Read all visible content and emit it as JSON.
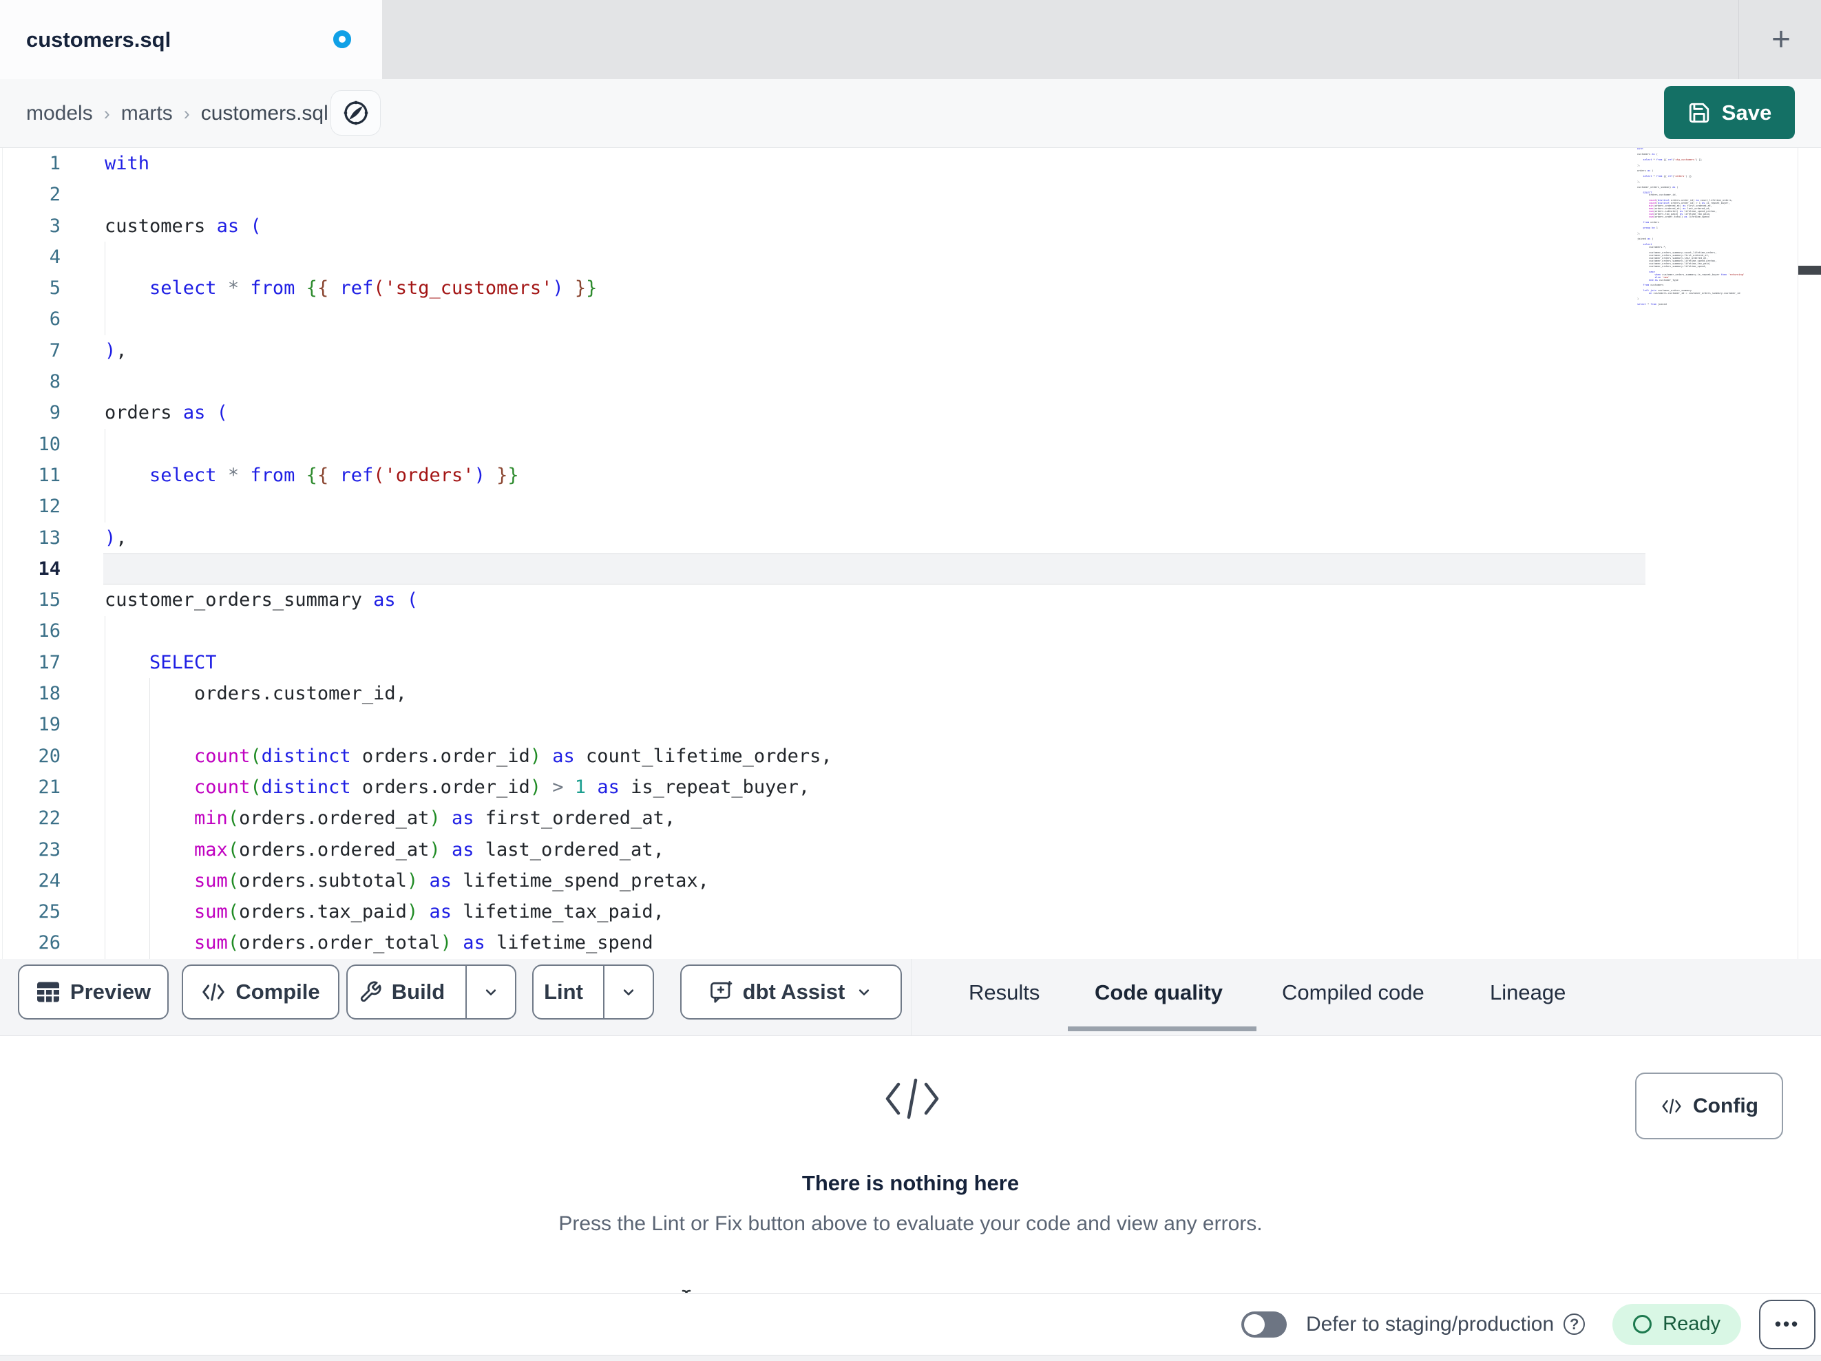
{
  "tab": {
    "title": "customers.sql"
  },
  "tabstrip": {
    "new_tab_glyph": "+"
  },
  "breadcrumb": {
    "items": [
      "models",
      "marts",
      "customers.sql"
    ],
    "separator": "›"
  },
  "save": {
    "label": "Save"
  },
  "editor": {
    "active_line": 14,
    "lines": [
      {
        "n": 1,
        "t": [
          [
            "with",
            "kw"
          ]
        ]
      },
      {
        "n": 2,
        "t": []
      },
      {
        "n": 3,
        "t": [
          [
            "customers",
            ""
          ],
          [
            " ",
            ""
          ],
          [
            "as",
            "kw"
          ],
          [
            " ",
            ""
          ],
          [
            "(",
            "kw"
          ]
        ]
      },
      {
        "n": 4,
        "t": []
      },
      {
        "n": 5,
        "t": [
          [
            "    ",
            ""
          ],
          [
            "select",
            "kw"
          ],
          [
            " ",
            ""
          ],
          [
            "*",
            "op"
          ],
          [
            " ",
            ""
          ],
          [
            "from",
            "kw"
          ],
          [
            " ",
            ""
          ],
          [
            "{",
            "bg"
          ],
          [
            "{",
            "bm"
          ],
          [
            " ",
            ""
          ],
          [
            "ref",
            "kw"
          ],
          [
            "(",
            "str"
          ],
          [
            "'stg_customers'",
            "str"
          ],
          [
            ")",
            "kw"
          ],
          [
            " ",
            ""
          ],
          [
            "}",
            "bm"
          ],
          [
            "}",
            "bg"
          ]
        ]
      },
      {
        "n": 6,
        "t": []
      },
      {
        "n": 7,
        "t": [
          [
            ")",
            "kw"
          ],
          [
            ",",
            ""
          ]
        ]
      },
      {
        "n": 8,
        "t": []
      },
      {
        "n": 9,
        "t": [
          [
            "orders",
            ""
          ],
          [
            " ",
            ""
          ],
          [
            "as",
            "kw"
          ],
          [
            " ",
            ""
          ],
          [
            "(",
            "kw"
          ]
        ]
      },
      {
        "n": 10,
        "t": []
      },
      {
        "n": 11,
        "t": [
          [
            "    ",
            ""
          ],
          [
            "select",
            "kw"
          ],
          [
            " ",
            ""
          ],
          [
            "*",
            "op"
          ],
          [
            " ",
            ""
          ],
          [
            "from",
            "kw"
          ],
          [
            " ",
            ""
          ],
          [
            "{",
            "bg"
          ],
          [
            "{",
            "bm"
          ],
          [
            " ",
            ""
          ],
          [
            "ref",
            "kw"
          ],
          [
            "(",
            "str"
          ],
          [
            "'orders'",
            "str"
          ],
          [
            ")",
            "kw"
          ],
          [
            " ",
            ""
          ],
          [
            "}",
            "bm"
          ],
          [
            "}",
            "bg"
          ]
        ]
      },
      {
        "n": 12,
        "t": []
      },
      {
        "n": 13,
        "t": [
          [
            ")",
            "kw"
          ],
          [
            ",",
            ""
          ]
        ]
      },
      {
        "n": 14,
        "t": []
      },
      {
        "n": 15,
        "t": [
          [
            "customer_orders_summary",
            ""
          ],
          [
            " ",
            ""
          ],
          [
            "as",
            "kw"
          ],
          [
            " ",
            ""
          ],
          [
            "(",
            "kw"
          ]
        ]
      },
      {
        "n": 16,
        "t": []
      },
      {
        "n": 17,
        "t": [
          [
            "    ",
            ""
          ],
          [
            "SELECT",
            "kw"
          ]
        ]
      },
      {
        "n": 18,
        "t": [
          [
            "        orders.customer_id,",
            ""
          ]
        ]
      },
      {
        "n": 19,
        "t": []
      },
      {
        "n": 20,
        "t": [
          [
            "        ",
            ""
          ],
          [
            "count",
            "fn"
          ],
          [
            "(",
            "par"
          ],
          [
            "distinct",
            "kw"
          ],
          [
            " orders.order_id",
            ""
          ],
          [
            ")",
            "par"
          ],
          [
            " ",
            ""
          ],
          [
            "as",
            "kw"
          ],
          [
            " count_lifetime_orders,",
            ""
          ]
        ]
      },
      {
        "n": 21,
        "t": [
          [
            "        ",
            ""
          ],
          [
            "count",
            "fn"
          ],
          [
            "(",
            "par"
          ],
          [
            "distinct",
            "kw"
          ],
          [
            " orders.order_id",
            ""
          ],
          [
            ")",
            "par"
          ],
          [
            " ",
            ""
          ],
          [
            ">",
            "op"
          ],
          [
            " ",
            ""
          ],
          [
            "1",
            "num"
          ],
          [
            " ",
            ""
          ],
          [
            "as",
            "kw"
          ],
          [
            " is_repeat_buyer,",
            ""
          ]
        ]
      },
      {
        "n": 22,
        "t": [
          [
            "        ",
            ""
          ],
          [
            "min",
            "fn"
          ],
          [
            "(",
            "par"
          ],
          [
            "orders.ordered_at",
            ""
          ],
          [
            ")",
            "par"
          ],
          [
            " ",
            ""
          ],
          [
            "as",
            "kw"
          ],
          [
            " first_ordered_at,",
            ""
          ]
        ]
      },
      {
        "n": 23,
        "t": [
          [
            "        ",
            ""
          ],
          [
            "max",
            "fn"
          ],
          [
            "(",
            "par"
          ],
          [
            "orders.ordered_at",
            ""
          ],
          [
            ")",
            "par"
          ],
          [
            " ",
            ""
          ],
          [
            "as",
            "kw"
          ],
          [
            " last_ordered_at,",
            ""
          ]
        ]
      },
      {
        "n": 24,
        "t": [
          [
            "        ",
            ""
          ],
          [
            "sum",
            "fn"
          ],
          [
            "(",
            "par"
          ],
          [
            "orders.subtotal",
            ""
          ],
          [
            ")",
            "par"
          ],
          [
            " ",
            ""
          ],
          [
            "as",
            "kw"
          ],
          [
            " lifetime_spend_pretax,",
            ""
          ]
        ]
      },
      {
        "n": 25,
        "t": [
          [
            "        ",
            ""
          ],
          [
            "sum",
            "fn"
          ],
          [
            "(",
            "par"
          ],
          [
            "orders.tax_paid",
            ""
          ],
          [
            ")",
            "par"
          ],
          [
            " ",
            ""
          ],
          [
            "as",
            "kw"
          ],
          [
            " lifetime_tax_paid,",
            ""
          ]
        ]
      },
      {
        "n": 26,
        "t": [
          [
            "        ",
            ""
          ],
          [
            "sum",
            "fn"
          ],
          [
            "(",
            "par"
          ],
          [
            "orders.order_total",
            ""
          ],
          [
            ")",
            "par"
          ],
          [
            " ",
            ""
          ],
          [
            "as",
            "kw"
          ],
          [
            " lifetime_spend",
            ""
          ]
        ]
      }
    ]
  },
  "minimap": {
    "lines": [
      "with",
      "",
      "customers as (",
      "",
      "    select * from {{ ref('stg_customers') }}",
      "",
      "),",
      "",
      "orders as (",
      "",
      "    select * from {{ ref('orders') }}",
      "",
      "),",
      "",
      "customer_orders_summary as (",
      "",
      "    SELECT",
      "        orders.customer_id,",
      "",
      "        count(distinct orders.order_id) as count_lifetime_orders,",
      "        count(distinct orders.order_id) > 1 as is_repeat_buyer,",
      "        min(orders.ordered_at) as first_ordered_at,",
      "        max(orders.ordered_at) as last_ordered_at,",
      "        sum(orders.subtotal) as lifetime_spend_pretax,",
      "        sum(orders.tax_paid) as lifetime_tax_paid,",
      "        sum(orders.order_total) as lifetime_spend",
      "",
      "    from orders",
      "",
      "    group by 1",
      "",
      "),",
      "",
      "joined as (",
      "",
      "    select",
      "        customers.*,",
      "",
      "        customer_orders_summary.count_lifetime_orders,",
      "        customer_orders_summary.first_ordered_at,",
      "        customer_orders_summary.last_ordered_at,",
      "        customer_orders_summary.lifetime_spend_pretax,",
      "        customer_orders_summary.lifetime_tax_paid,",
      "        customer_orders_summary.lifetime_spend,",
      "",
      "        case",
      "            when customer_orders_summary.is_repeat_buyer then 'returning'",
      "            else 'new'",
      "        end as customer_type",
      "",
      "    from customers",
      "",
      "    left join customer_orders_summary",
      "        on customers.customer_id = customer_orders_summary.customer_id",
      "",
      ")",
      "",
      "select * from joined"
    ]
  },
  "toolbar": {
    "buttons": [
      {
        "label": "Preview"
      },
      {
        "label": "Compile"
      },
      {
        "label": "Build"
      },
      {
        "label": "Lint"
      },
      {
        "label": "dbt Assist"
      }
    ],
    "tabs": [
      {
        "label": "Results"
      },
      {
        "label": "Code quality"
      },
      {
        "label": "Compiled code"
      },
      {
        "label": "Lineage"
      }
    ]
  },
  "panel": {
    "title": "There is nothing here",
    "subtitle": "Press the Lint or Fix button above to evaluate your code and view any errors.",
    "config_label": "Config"
  },
  "statusbar": {
    "defer_label": "Defer to staging/production",
    "help_glyph": "?",
    "ready_label": "Ready",
    "more_glyph": "•••"
  },
  "colors": {
    "accent_teal": "#147065",
    "unsaved_dot_blue": "#10a0e6",
    "ready_bg": "#d9f7e5",
    "ready_green": "#1d7a4f",
    "keyword_blue": "#1e1ee4",
    "function_magenta": "#c000c0",
    "string_maroon": "#a31515",
    "active_tab_underline": "#9aa2ac"
  }
}
